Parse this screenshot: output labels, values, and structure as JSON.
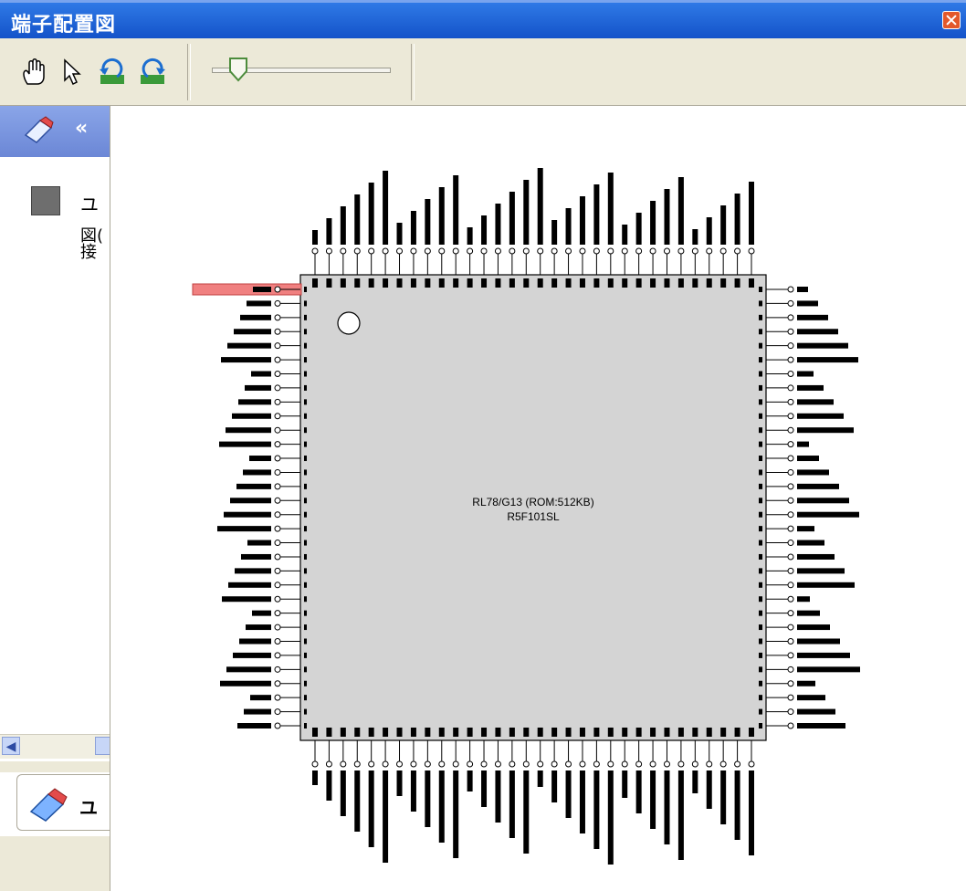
{
  "window": {
    "title": "端子配置図"
  },
  "toolbar": {
    "zoom_level": 0.12
  },
  "left_panel": {
    "collapse_glyph": "«",
    "item_label": "ユ",
    "item_desc": "図(\n接",
    "tab_label": "ユ"
  },
  "chip": {
    "name": "RL78/G13 (ROM:512KB)",
    "part": "R5F101SL",
    "pins_per_side": 32,
    "highlighted_pin": "left-1"
  },
  "colors": {
    "title_bar": "#1f5fd6",
    "highlight": "#f08080",
    "chip_body": "#d4d4d4",
    "panel_header": "#7a96df"
  }
}
